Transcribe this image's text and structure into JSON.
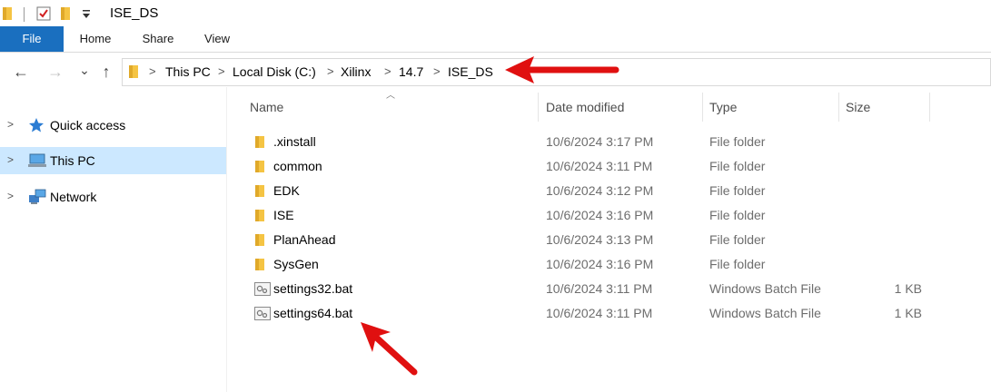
{
  "window": {
    "title": "ISE_DS"
  },
  "quick_access": {
    "icons": [
      "folder-icon",
      "properties-check-icon",
      "new-folder-icon",
      "customize-dropdown-icon"
    ]
  },
  "ribbon": {
    "tabs": [
      "File",
      "Home",
      "Share",
      "View"
    ]
  },
  "nav": {
    "back": "←",
    "forward": "→",
    "recent": "⌄",
    "up": "↑"
  },
  "address": {
    "breadcrumbs": [
      "This PC",
      "Local Disk (C:)",
      "Xilinx",
      "14.7",
      "ISE_DS"
    ]
  },
  "sidebar": {
    "items": [
      {
        "label": "Quick access",
        "icon": "star-icon",
        "selected": false
      },
      {
        "label": "This PC",
        "icon": "computer-icon",
        "selected": true
      },
      {
        "label": "Network",
        "icon": "network-icon",
        "selected": false
      }
    ]
  },
  "columns": {
    "name": "Name",
    "date": "Date modified",
    "type": "Type",
    "size": "Size"
  },
  "files": [
    {
      "name": ".xinstall",
      "date": "10/6/2024 3:17 PM",
      "type": "File folder",
      "size": "",
      "icon": "folder-icon"
    },
    {
      "name": "common",
      "date": "10/6/2024 3:11 PM",
      "type": "File folder",
      "size": "",
      "icon": "folder-icon"
    },
    {
      "name": "EDK",
      "date": "10/6/2024 3:12 PM",
      "type": "File folder",
      "size": "",
      "icon": "folder-icon"
    },
    {
      "name": "ISE",
      "date": "10/6/2024 3:16 PM",
      "type": "File folder",
      "size": "",
      "icon": "folder-icon"
    },
    {
      "name": "PlanAhead",
      "date": "10/6/2024 3:13 PM",
      "type": "File folder",
      "size": "",
      "icon": "folder-icon"
    },
    {
      "name": "SysGen",
      "date": "10/6/2024 3:16 PM",
      "type": "File folder",
      "size": "",
      "icon": "folder-icon"
    },
    {
      "name": "settings32.bat",
      "date": "10/6/2024 3:11 PM",
      "type": "Windows Batch File",
      "size": "1 KB",
      "icon": "batch-file-icon"
    },
    {
      "name": "settings64.bat",
      "date": "10/6/2024 3:11 PM",
      "type": "Windows Batch File",
      "size": "1 KB",
      "icon": "batch-file-icon"
    }
  ],
  "colors": {
    "file_tab": "#1a6fbf",
    "selected_nav": "#cce8ff",
    "folder": "#f5c443",
    "annotation_arrow": "#e01010"
  }
}
